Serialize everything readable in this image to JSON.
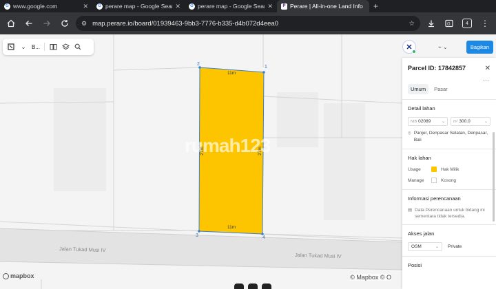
{
  "browser": {
    "tabs": [
      {
        "title": "www.google.com",
        "favicon": "google-icon",
        "active": false
      },
      {
        "title": "perare map - Google Search",
        "favicon": "google-icon",
        "active": false
      },
      {
        "title": "perare map - Google Search",
        "favicon": "google-icon",
        "active": false
      },
      {
        "title": "Perare | All-in-one Land Info",
        "favicon": "perare-icon",
        "active": true
      }
    ],
    "url": "map.perare.io/board/01939463-9bb3-7776-b335-d4b072d4eea0",
    "extension_count": "4"
  },
  "map_toolbar": {
    "basemap_label": "B..."
  },
  "top_right": {
    "brand_letter": "✕",
    "share_label": "Bagikan"
  },
  "map": {
    "road_labels": [
      "Jalan Tukad Musi IV",
      "Jalan Tukad Musi IV"
    ],
    "watermark": "rumah123",
    "vertices": [
      "1",
      "2",
      "3",
      "4"
    ],
    "dimensions": {
      "top": "11m",
      "bottom": "11m",
      "left": "27m",
      "right": "27m"
    },
    "parcel_color": "#FDC500",
    "mapbox_logo": "mapbox",
    "attribution": "© Mapbox © O"
  },
  "panel": {
    "parcel_id_label": "Parcel ID: 17842857",
    "close": "✕",
    "more": "···",
    "tabs": [
      "Umum",
      "Pasar"
    ],
    "detail_lahan": {
      "title": "Detail lahan",
      "nib_prefix": "NIB",
      "nib_value": "02089",
      "area_prefix": "m²",
      "area_value": "300.0",
      "location": "Panjer, Denpasar Selatan, Denpasar, Bali"
    },
    "hak_lahan": {
      "title": "Hak lahan",
      "usage_label": "Usage",
      "usage_value": "Hak Milik",
      "usage_color": "#FDC500",
      "manage_label": "Manage",
      "manage_value": "Kosong"
    },
    "perencanaan": {
      "title": "Informasi perencanaan",
      "note": "Data Perencanaan untuk bidang ini sementara tidak tersedia."
    },
    "akses_jalan": {
      "title": "Akses jalan",
      "source": "OSM",
      "type": "Private"
    },
    "posisi": {
      "title": "Posisi"
    }
  }
}
